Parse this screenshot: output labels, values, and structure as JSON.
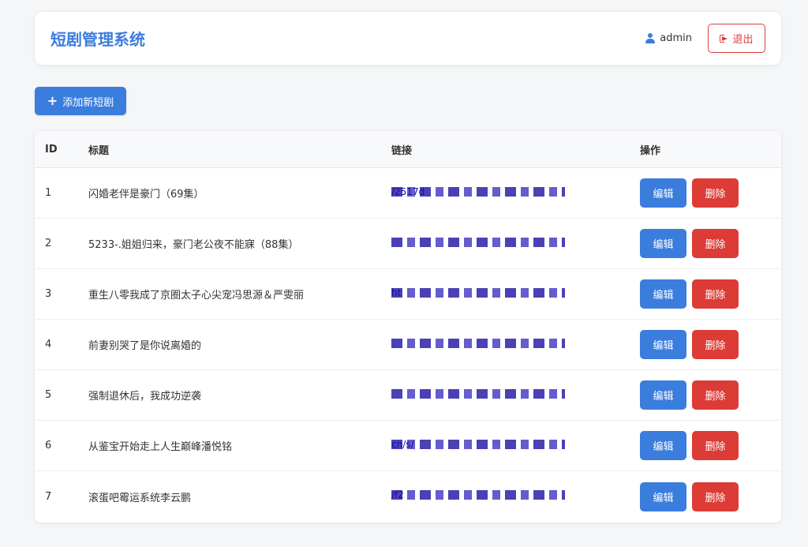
{
  "header": {
    "title": "短剧管理系统",
    "username": "admin",
    "logout_label": "退出"
  },
  "toolbar": {
    "add_label": "添加新短剧"
  },
  "table": {
    "columns": {
      "id": "ID",
      "title": "标题",
      "link": "链接",
      "actions": "操作"
    },
    "rows": [
      {
        "id": "1",
        "title": "闪婚老伴是豪门（69集）",
        "link": "/2517d",
        "edit": "编辑",
        "delete": "删除"
      },
      {
        "id": "2",
        "title": "5233-.姐姐归来，豪门老公夜不能寐（88集）",
        "link": "",
        "edit": "编辑",
        "delete": "删除"
      },
      {
        "id": "3",
        "title": "重生八零我成了京圈太子心尖宠冯思源＆严雯丽",
        "link": "ht",
        "edit": "编辑",
        "delete": "删除"
      },
      {
        "id": "4",
        "title": "前妻别哭了是你说离婚的",
        "link": "",
        "edit": "编辑",
        "delete": "删除"
      },
      {
        "id": "5",
        "title": "强制退休后，我成功逆袭",
        "link": "",
        "edit": "编辑",
        "delete": "删除"
      },
      {
        "id": "6",
        "title": "从鉴宝开始走上人生巅峰潘悦铭",
        "link": "cn/s/",
        "edit": "编辑",
        "delete": "删除"
      },
      {
        "id": "7",
        "title": "滚蛋吧霉运系统李云鹏",
        "link": "/f2",
        "edit": "编辑",
        "delete": "删除"
      }
    ]
  }
}
